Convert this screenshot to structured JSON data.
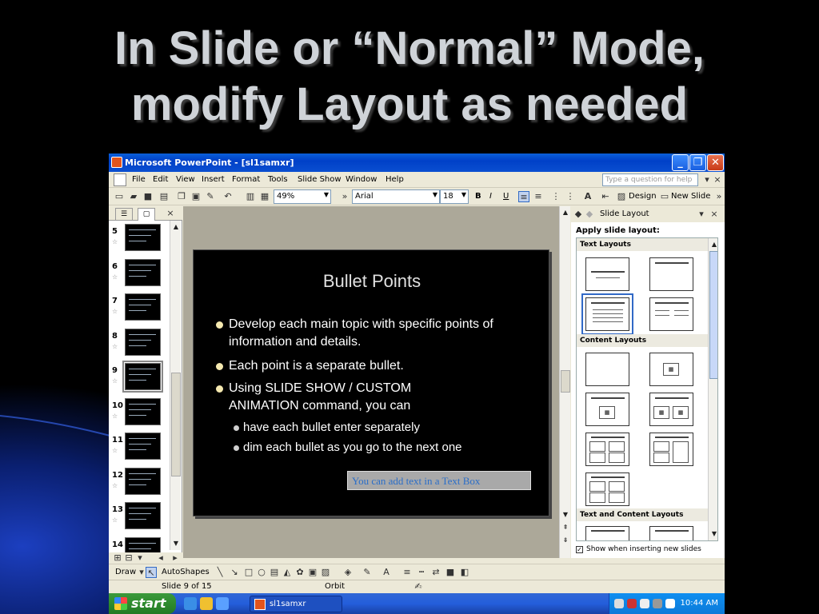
{
  "heading": {
    "line1": "In Slide or “Normal” Mode,",
    "line2": "modify Layout as needed"
  },
  "window": {
    "title": "Microsoft PowerPoint - [sl1samxr]",
    "minimize": "_",
    "restore": "❐",
    "close": "✕"
  },
  "menu": {
    "items": [
      "File",
      "Edit",
      "View",
      "Insert",
      "Format",
      "Tools",
      "Slide Show",
      "Window",
      "Help"
    ],
    "help_placeholder": "Type a question for help"
  },
  "toolbar": {
    "zoom": "49%",
    "font": "Arial",
    "font_size": "18",
    "bold": "B",
    "italic": "I",
    "underline": "U",
    "design_label": "Design",
    "new_slide_label": "New Slide"
  },
  "outline": {
    "thumbs": [
      "5",
      "6",
      "7",
      "8",
      "9",
      "10",
      "11",
      "12",
      "13",
      "14"
    ],
    "selected": "9"
  },
  "slide": {
    "title": "Bullet Points",
    "bullets": [
      "Develop each main topic with specific points of information and details.",
      "Each point is a separate bullet.",
      "Using SLIDE SHOW / CUSTOM ANIMATION command, you can"
    ],
    "sub_bullets": [
      "have each bullet enter separately",
      "dim each bullet as you go to the next one"
    ],
    "text_box": "You can add text in a Text Box"
  },
  "task_pane": {
    "title": "Slide Layout",
    "apply_label": "Apply slide layout:",
    "groups": [
      "Text Layouts",
      "Content Layouts",
      "Text and Content Layouts"
    ],
    "show_when_inserting": "Show when inserting new slides"
  },
  "drawbar": {
    "draw_label": "Draw",
    "autoshapes_label": "AutoShapes"
  },
  "status": {
    "slide_of": "Slide 9 of 15",
    "design": "Orbit"
  },
  "taskbar": {
    "start_label": "start",
    "task_item": "sl1samxr",
    "clock": "10:44 AM"
  },
  "colors": {
    "title_text": "#cfd3d8",
    "xp_blue": "#0040c8",
    "textbox_text": "#2b6ec8"
  }
}
